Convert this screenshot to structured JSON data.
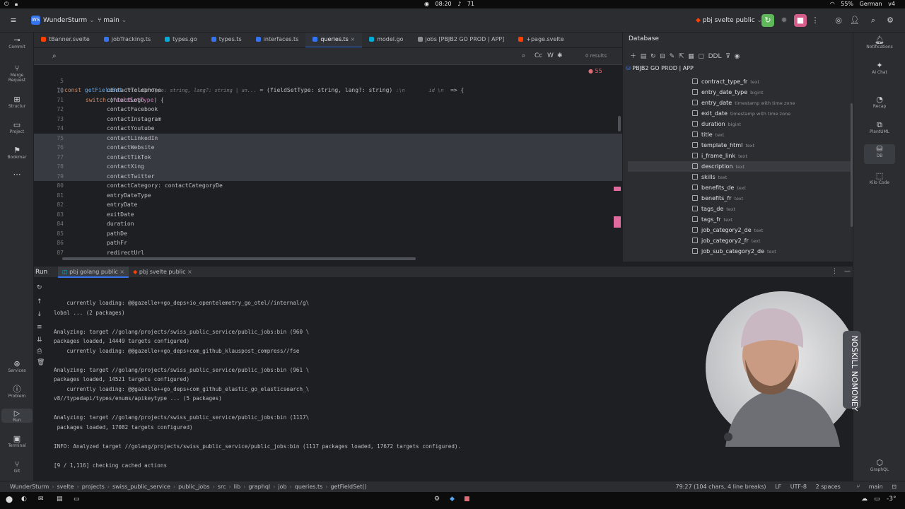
{
  "os_top": {
    "time": "08:20",
    "counter": "71",
    "battery": "55%",
    "keyboard": "German",
    "volume": "v4"
  },
  "header": {
    "project_badge": "WS",
    "project_name": "WunderSturm",
    "branch": "main",
    "run_config": "pbj svelte public"
  },
  "left_strip": {
    "commit": "Commit",
    "merge": "Merge Request",
    "structure": "Structur",
    "project": "Project",
    "bookmarks": "Bookmar",
    "services": "Services",
    "problems": "Problem",
    "run": "Run",
    "terminal": "Terminal",
    "git": "Git"
  },
  "right_strip": {
    "notifications": "Notifications",
    "ai_chat": "AI Chat",
    "recap": "Recap",
    "plantuml": "PlantUML",
    "db": "DB",
    "kilo": "Kilo Code",
    "graphql": "GraphQL"
  },
  "editor_tabs": [
    {
      "label": "tBanner.svelte",
      "color": "#ff3e00"
    },
    {
      "label": "jobTracking.ts",
      "color": "#3574f0"
    },
    {
      "label": "types.go",
      "color": "#00add8"
    },
    {
      "label": "types.ts",
      "color": "#3574f0"
    },
    {
      "label": "interfaces.ts",
      "color": "#3574f0"
    },
    {
      "label": "queries.ts",
      "color": "#3574f0"
    },
    {
      "label": "model.go",
      "color": "#00add8"
    },
    {
      "label": "jobs [PBJB2 GO PROD | APP]",
      "color": "#8c8f94"
    },
    {
      "label": "+page.svelte",
      "color": "#ff3e00"
    }
  ],
  "search": {
    "results": "0 results",
    "match_case": "Cc",
    "word": "W"
  },
  "editor": {
    "warnings": "55",
    "signature_line": {
      "num": "5",
      "code_a": "const ",
      "fn": "getFieldSet",
      "hint_a": " (fieldSetType: string, lang?: string | un...",
      "code_b": " = (fieldSetType: string, lang?: string) ",
      "hint_b": ":\\n        id \\n",
      "arrow": "  => {"
    },
    "switch_line": {
      "num": "10",
      "code": "switch (fieldSetType) {"
    },
    "lines": [
      {
        "num": "70",
        "code": "contactTelephone",
        "selected": false
      },
      {
        "num": "71",
        "code": "contactLogo",
        "selected": false
      },
      {
        "num": "72",
        "code": "contactFacebook",
        "selected": false
      },
      {
        "num": "73",
        "code": "contactInstagram",
        "selected": false
      },
      {
        "num": "74",
        "code": "contactYoutube",
        "selected": false
      },
      {
        "num": "75",
        "code": "contactLinkedIn",
        "selected": true
      },
      {
        "num": "76",
        "code": "contactWebsite",
        "selected": true
      },
      {
        "num": "77",
        "code": "contactTikTok",
        "selected": true
      },
      {
        "num": "78",
        "code": "contactXing",
        "selected": true
      },
      {
        "num": "79",
        "code": "contactTwitter",
        "selected": true
      },
      {
        "num": "80",
        "code": "contactCategory: contactCategoryDe",
        "selected": false
      },
      {
        "num": "81",
        "code": "entryDateType",
        "selected": false
      },
      {
        "num": "82",
        "code": "entryDate",
        "selected": false
      },
      {
        "num": "83",
        "code": "exitDate",
        "selected": false
      },
      {
        "num": "84",
        "code": "duration",
        "selected": false
      },
      {
        "num": "85",
        "code": "pathDe",
        "selected": false
      },
      {
        "num": "86",
        "code": "pathFr",
        "selected": false
      },
      {
        "num": "87",
        "code": "redirectUrl",
        "selected": false
      }
    ]
  },
  "database": {
    "title": "Database",
    "ddl": "DDL",
    "connection": "PBJB2 GO PROD | APP",
    "columns": [
      {
        "name": "contract_type_fr",
        "type": "text"
      },
      {
        "name": "entry_date_type",
        "type": "bigint"
      },
      {
        "name": "entry_date",
        "type": "timestamp with time zone"
      },
      {
        "name": "exit_date",
        "type": "timestamp with time zone"
      },
      {
        "name": "duration",
        "type": "bigint"
      },
      {
        "name": "title",
        "type": "text"
      },
      {
        "name": "template_html",
        "type": "text"
      },
      {
        "name": "i_frame_link",
        "type": "text"
      },
      {
        "name": "description",
        "type": "text"
      },
      {
        "name": "skills",
        "type": "text"
      },
      {
        "name": "benefits_de",
        "type": "text"
      },
      {
        "name": "benefits_fr",
        "type": "text"
      },
      {
        "name": "tags_de",
        "type": "text"
      },
      {
        "name": "tags_fr",
        "type": "text"
      },
      {
        "name": "job_category2_de",
        "type": "text"
      },
      {
        "name": "job_category2_fr",
        "type": "text"
      },
      {
        "name": "job_sub_category2_de",
        "type": "text"
      }
    ]
  },
  "run": {
    "label": "Run",
    "tabs": [
      {
        "label": "pbj golang public"
      },
      {
        "label": "pbj svelte public"
      }
    ],
    "console": [
      "    currently loading: @@gazelle++go_deps+io_opentelemetry_go_otel//internal/g\\",
      "lobal ... (2 packages)",
      "",
      "Analyzing: target //golang/projects/swiss_public_service/public_jobs:bin (960 \\",
      "packages loaded, 14449 targets configured)",
      "    currently loading: @@gazelle++go_deps+com_github_klauspost_compress//fse",
      "",
      "Analyzing: target //golang/projects/swiss_public_service/public_jobs:bin (961 \\",
      "packages loaded, 14521 targets configured)",
      "    currently loading: @@gazelle++go_deps+com_github_elastic_go_elasticsearch_\\",
      "v8//typedapi/types/enums/apikeytype ... (5 packages)",
      "",
      "Analyzing: target //golang/projects/swiss_public_service/public_jobs:bin (1117\\",
      " packages loaded, 17082 targets configured)",
      "",
      "INFO: Analyzed target //golang/projects/swiss_public_service/public_jobs:bin (1117 packages loaded, 17672 targets configured).",
      "",
      "[9 / 1,116] checking cached actions"
    ]
  },
  "status_bar": {
    "crumbs": [
      "WunderSturm",
      "svelte",
      "projects",
      "swiss_public_service",
      "public_jobs",
      "src",
      "lib",
      "graphql",
      "job",
      "queries.ts",
      "getFieldSet()"
    ],
    "position": "79:27 (104 chars, 4 line breaks)",
    "line_ending": "LF",
    "encoding": "UTF-8",
    "indent": "2 spaces",
    "branch": "main"
  },
  "webcam": {
    "cap_text": "NOSKILL NOMONEY"
  },
  "os_bottom": {
    "temp": "-3°"
  }
}
